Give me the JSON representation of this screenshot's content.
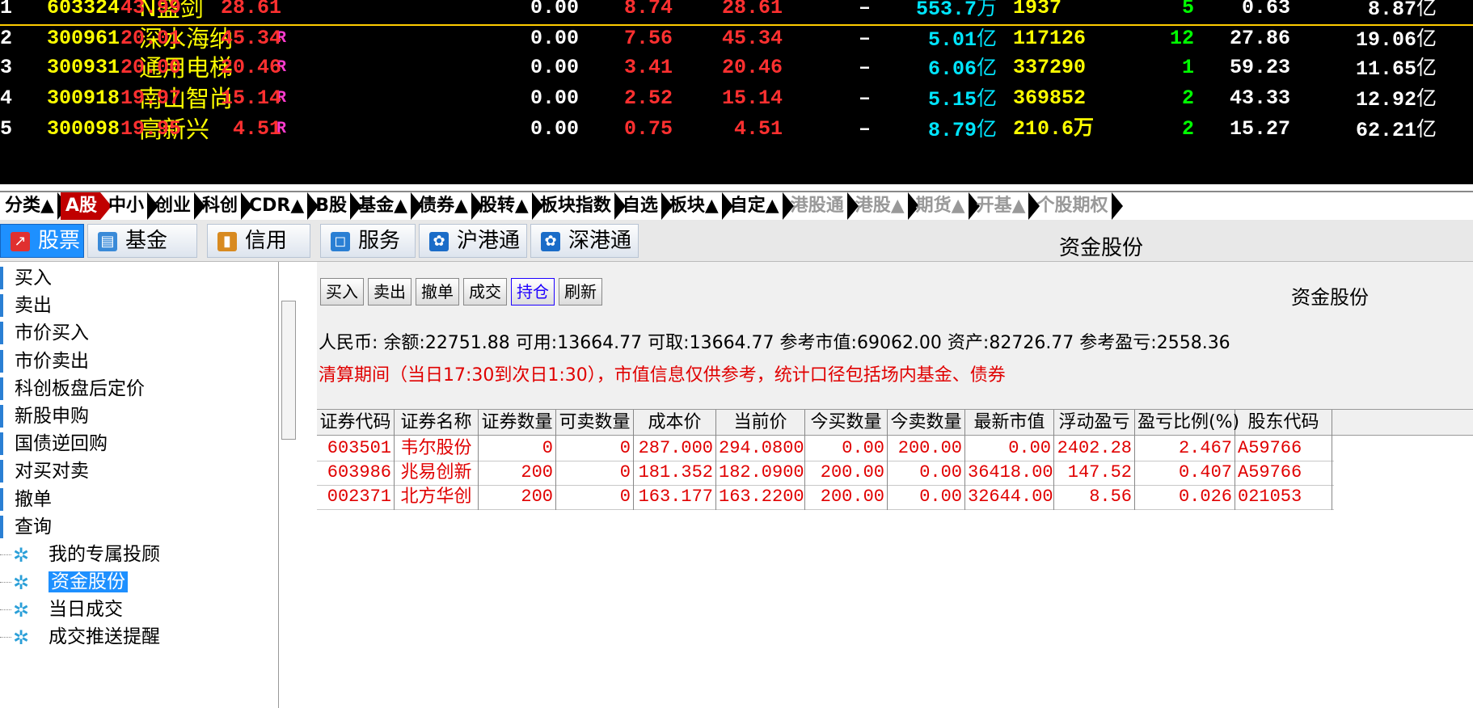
{
  "quote_rows": [
    {
      "idx": "1",
      "code": "603324",
      "name": "N盛剑",
      "flag": "",
      "a": "43.99",
      "b": "28.61",
      "c": "0.00",
      "d": "8.74",
      "e": "28.61",
      "f": "–",
      "vol_num": "553.7",
      "vol_unit": "万",
      "amt": "1937",
      "n": "5",
      "pe": "0.63",
      "mv_num": "8.87",
      "mv_unit": "亿"
    },
    {
      "idx": "2",
      "code": "300961",
      "name": "深水海纳",
      "flag": "R",
      "a": "20.01",
      "b": "45.34",
      "c": "0.00",
      "d": "7.56",
      "e": "45.34",
      "f": "–",
      "vol_num": "5.01",
      "vol_unit": "亿",
      "amt": "117126",
      "n": "12",
      "pe": "27.86",
      "mv_num": "19.06",
      "mv_unit": "亿"
    },
    {
      "idx": "3",
      "code": "300931",
      "name": "通用电梯",
      "flag": "R",
      "a": "20.00",
      "b": "20.46",
      "c": "0.00",
      "d": "3.41",
      "e": "20.46",
      "f": "–",
      "vol_num": "6.06",
      "vol_unit": "亿",
      "amt": "337290",
      "n": "1",
      "pe": "59.23",
      "mv_num": "11.65",
      "mv_unit": "亿"
    },
    {
      "idx": "4",
      "code": "300918",
      "name": "南山智尚",
      "flag": "R",
      "a": "19.97",
      "b": "15.14",
      "c": "0.00",
      "d": "2.52",
      "e": "15.14",
      "f": "–",
      "vol_num": "5.15",
      "vol_unit": "亿",
      "amt": "369852",
      "n": "2",
      "pe": "43.33",
      "mv_num": "12.92",
      "mv_unit": "亿"
    },
    {
      "idx": "5",
      "code": "300098",
      "name": "高新兴",
      "flag": "R",
      "a": "19.95",
      "b": "4.51",
      "c": "0.00",
      "d": "0.75",
      "e": "4.51",
      "f": "–",
      "vol_num": "8.79",
      "vol_unit": "亿",
      "amt": "210.6万",
      "n": "2",
      "pe": "15.27",
      "mv_num": "62.21",
      "mv_unit": "亿"
    }
  ],
  "market_tabs": [
    {
      "label": "分类▲",
      "state": "normal"
    },
    {
      "label": "A股",
      "state": "active"
    },
    {
      "label": "中小",
      "state": "normal"
    },
    {
      "label": "创业",
      "state": "normal"
    },
    {
      "label": "科创",
      "state": "normal"
    },
    {
      "label": "CDR▲",
      "state": "normal"
    },
    {
      "label": "B股",
      "state": "normal"
    },
    {
      "label": "基金▲",
      "state": "normal"
    },
    {
      "label": "债券▲",
      "state": "normal"
    },
    {
      "label": "股转▲",
      "state": "normal"
    },
    {
      "label": "板块指数",
      "state": "normal"
    },
    {
      "label": "自选",
      "state": "normal"
    },
    {
      "label": "板块▲",
      "state": "normal"
    },
    {
      "label": "自定▲",
      "state": "normal"
    },
    {
      "label": "港股通",
      "state": "dim"
    },
    {
      "label": "港股▲",
      "state": "dim"
    },
    {
      "label": "期货▲",
      "state": "dim"
    },
    {
      "label": "开基▲",
      "state": "dim"
    },
    {
      "label": "个股期权",
      "state": "dim"
    }
  ],
  "toolbar": {
    "tabs": [
      {
        "label": "股票",
        "icon": "stock-chart-icon",
        "active": true
      },
      {
        "label": "基金",
        "icon": "fund-chart-icon",
        "active": false
      },
      {
        "label": "信用",
        "icon": "credit-icon",
        "active": false
      },
      {
        "label": "服务",
        "icon": "service-icon",
        "active": false
      },
      {
        "label": "沪港通",
        "icon": "hk-flag-icon",
        "active": false
      },
      {
        "label": "深港通",
        "icon": "hk-flag-icon",
        "active": false
      }
    ],
    "title": "资金股份"
  },
  "sidebar": {
    "items": [
      "买入",
      "卖出",
      "市价买入",
      "市价卖出",
      "科创板盘后定价",
      "新股申购",
      "国债逆回购",
      "对买对卖",
      "撤单",
      "查询"
    ],
    "sub_items": [
      {
        "label": "我的专属投顾",
        "selected": false
      },
      {
        "label": "资金股份",
        "selected": true
      },
      {
        "label": "当日成交",
        "selected": false
      },
      {
        "label": "成交推送提醒",
        "selected": false
      }
    ]
  },
  "actions": {
    "buttons": [
      {
        "label": "买入",
        "active": false
      },
      {
        "label": "卖出",
        "active": false
      },
      {
        "label": "撤单",
        "active": false
      },
      {
        "label": "成交",
        "active": false
      },
      {
        "label": "持仓",
        "active": true
      },
      {
        "label": "刷新",
        "active": false
      }
    ],
    "title": "资金股份"
  },
  "summary": "人民币: 余额:22751.88  可用:13664.77  可取:13664.77  参考市值:69062.00  资产:82726.77  参考盈亏:2558.36",
  "notice": "清算期间（当日17:30到次日1:30），市值信息仅供参考，统计口径包括场内基金、债券",
  "holdings": {
    "columns": [
      "证券代码",
      "证券名称",
      "证券数量",
      "可卖数量",
      "成本价",
      "当前价",
      "今买数量",
      "今卖数量",
      "最新市值",
      "浮动盈亏",
      "盈亏比例(%)",
      "股东代码"
    ],
    "rows": [
      [
        "603501",
        "韦尔股份",
        "0",
        "0",
        "287.000",
        "294.0800",
        "0.00",
        "200.00",
        "0.00",
        "2402.28",
        "2.467",
        "A59766"
      ],
      [
        "603986",
        "兆易创新",
        "200",
        "0",
        "181.352",
        "182.0900",
        "200.00",
        "0.00",
        "36418.00",
        "147.52",
        "0.407",
        "A59766"
      ],
      [
        "002371",
        "北方华创",
        "200",
        "0",
        "163.177",
        "163.2200",
        "200.00",
        "0.00",
        "32644.00",
        "8.56",
        "0.026",
        "021053"
      ]
    ]
  }
}
